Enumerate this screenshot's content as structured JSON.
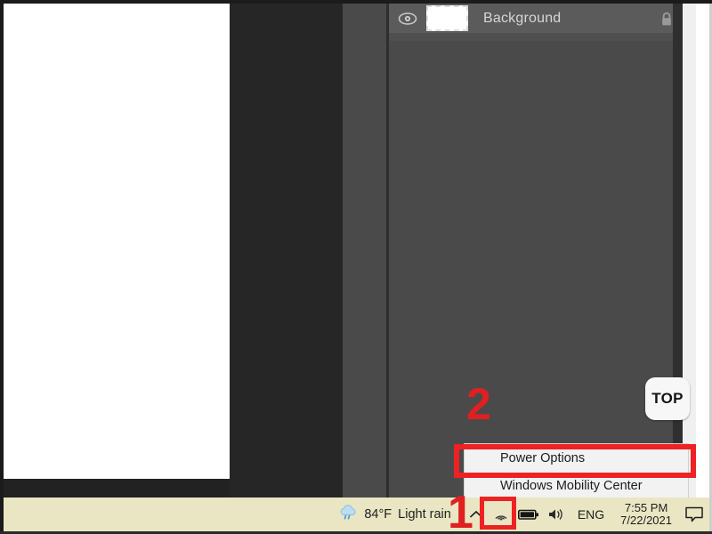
{
  "app": {
    "name": "image-editor",
    "layers_panel": {
      "layer": {
        "name": "Background",
        "visibility_icon": "eye-icon",
        "lock_icon": "lock-icon",
        "thumbnail": "layer-thumbnail"
      }
    }
  },
  "overlay": {
    "top_badge": "TOP",
    "annotations": [
      {
        "id": "1",
        "label": "1"
      },
      {
        "id": "2",
        "label": "2"
      }
    ]
  },
  "context_menu": {
    "items": [
      {
        "label": "Power Options",
        "highlighted": true
      },
      {
        "label": "Windows Mobility Center",
        "highlighted": false
      }
    ]
  },
  "taskbar": {
    "weather": {
      "icon": "rain-cloud-icon",
      "temperature": "84°F",
      "condition": "Light rain"
    },
    "tray": {
      "show_hidden_icons": "chevron-up-icon",
      "network": "wifi-icon",
      "battery": "battery-icon",
      "volume": "speaker-icon"
    },
    "language": "ENG",
    "clock": {
      "time": "7:55 PM",
      "date": "7/22/2021"
    },
    "notifications": "chat-bubble-icon"
  },
  "colors": {
    "accent_red": "#ee2222",
    "taskbar_bg": "#eae6c3",
    "panel_bg": "#4a4a4a",
    "layer_row_bg": "#5b5b5b",
    "canvas_bg": "#ffffff",
    "menu_bg": "#f2f2f2"
  }
}
